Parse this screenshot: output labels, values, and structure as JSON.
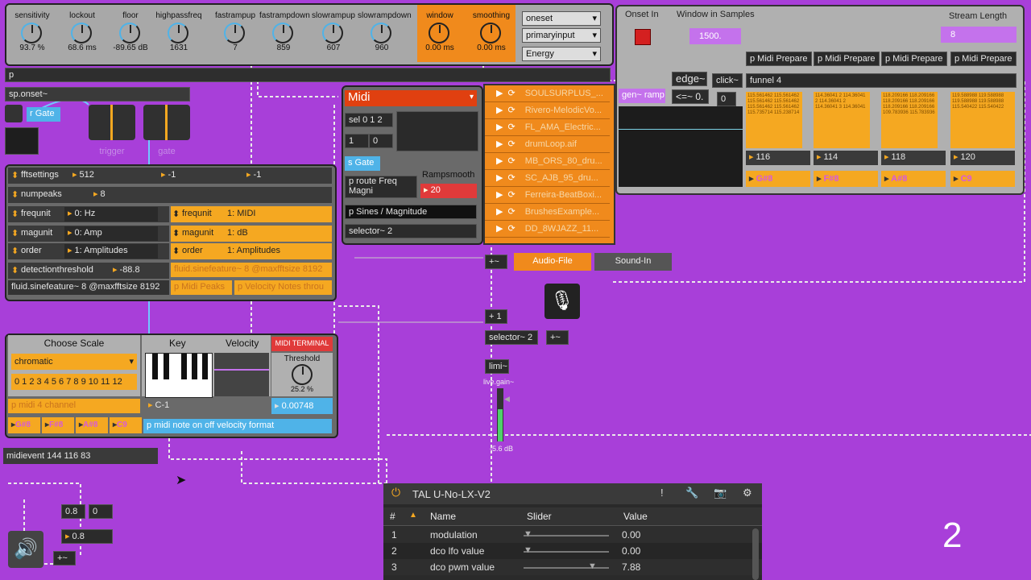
{
  "top_params": [
    {
      "label": "sensitivity",
      "value": "93.7 %"
    },
    {
      "label": "lockout",
      "value": "68.6 ms"
    },
    {
      "label": "floor",
      "value": "-89.65 dB"
    },
    {
      "label": "highpassfreq",
      "value": "1631"
    },
    {
      "label": "fastrampup",
      "value": "7"
    },
    {
      "label": "fastrampdown",
      "value": "859"
    },
    {
      "label": "slowrampup",
      "value": "607"
    },
    {
      "label": "slowrampdown",
      "value": "960"
    },
    {
      "label": "window",
      "value": "0.00 ms"
    },
    {
      "label": "smoothing",
      "value": "0.00 ms"
    }
  ],
  "menus": {
    "oneset": "oneset",
    "primaryinput": "primaryinput",
    "energy": "Energy"
  },
  "objects": {
    "p": "p",
    "sponset": "sp.onset~",
    "rgate": "r Gate",
    "trigger": "trigger",
    "gate": "gate",
    "sel012": "sel 0 1 2",
    "one": "1",
    "zero": "0",
    "sgate": "s Gate",
    "proute": "p route Freq Magni",
    "rampsmooth": "Rampsmooth",
    "ramp_val": "20",
    "psines": "p Sines / Magnitude",
    "selector2": "selector~ 2",
    "midi_menu": "Midi",
    "plusneg": "+~",
    "audio_file": "Audio-File",
    "sound_in": "Sound-In",
    "plus1": "+ 1",
    "selector2b": "selector~ 2",
    "plusb": "+~",
    "limi": "limi~",
    "livegain": "live.gain~",
    "db": "-5.6 dB",
    "midievent": "midievent 144 116 83",
    "v08a": "0.8",
    "v0": "0",
    "v08b": "0.8",
    "plusc": "+~"
  },
  "fluid": [
    {
      "name": "fftsettings",
      "v1": "512",
      "v2": "-1",
      "v3": "-1"
    },
    {
      "name": "numpeaks",
      "v1": "8"
    },
    {
      "name": "frequnit",
      "v1": "0: Hz",
      "name2": "frequnit",
      "v2": "1: MIDI"
    },
    {
      "name": "magunit",
      "v1": "0: Amp",
      "name2": "magunit",
      "v2": "1: dB"
    },
    {
      "name": "order",
      "v1": "1: Amplitudes",
      "name2": "order",
      "v2": "1: Amplitudes"
    },
    {
      "name": "detectionthreshold",
      "v1": "-88.8"
    }
  ],
  "fluid_texts": {
    "sinefeature_a": "fluid.sinefeature~ 8 @maxfftsize 8192",
    "sinefeature_b": "fluid.sinefeature~ 8 @maxfftsize 8192",
    "pmidipeaks": "p Midi Peaks",
    "pvelocity": "p Velocity Notes throu"
  },
  "clips": [
    "SOULSURPLUS_...",
    "Rivero-MelodicVo...",
    "FL_AMA_Electric...",
    "drumLoop.aif",
    "MB_ORS_80_dru...",
    "SC_AJB_95_dru...",
    "Ferreira-BeatBoxi...",
    "BrushesExample...",
    "DD_8WJAZZ_11..."
  ],
  "onset_panel": {
    "onset_in": "Onset In",
    "window_samples": "Window in Samples",
    "window_val": "1500.",
    "stream_length": "Stream Length",
    "stream_val": "8",
    "genramp": "gen~ ramp",
    "edge": "edge~",
    "click": "click~",
    "lte": "<=~ 0.",
    "zero": "0",
    "funnel": "funnel 4",
    "prepare": [
      "p Midi Prepare",
      "p Midi Prepare",
      "p Midi Prepare",
      "p Midi Prepare"
    ],
    "numbers": [
      "116",
      "114",
      "118",
      "120"
    ],
    "notes": [
      "G#8",
      "F#8",
      "A#8",
      "C9"
    ],
    "seq": [
      "115.561462 115.561462 115.561462 115.561462 115.561462 115.561462 115.735714 115.238714",
      "114.36041 2 114.36041 2 114.36041 2 114.36041 3 114.36041",
      "118.209166 118.209166 118.209166 118.209166 118.209166 118.209166 109.783936 115.783936",
      "119.588988 119.588988 119.588988 119.588988 115.540422 115.540422"
    ]
  },
  "scale_panel": {
    "choose_scale": "Choose Scale",
    "scale": "chromatic",
    "degrees": "0 1 2 3 4 5 6 7 8 9 10 11 12",
    "key": "Key",
    "velocity": "Velocity",
    "midi_terminal": "MIDI TERMINAL",
    "threshold": "Threshold",
    "threshold_val": "25.2 %",
    "pmidi4": "p midi 4 channel",
    "c1": "C-1",
    "thr_num": "0.00748",
    "notes": [
      "G#8",
      "F#8",
      "A#8",
      "C9"
    ],
    "pnote": "p midi note on off velocity format"
  },
  "plugin": {
    "title": "TAL U-No-LX-V2",
    "headers": {
      "num": "#",
      "name": "Name",
      "slider": "Slider",
      "value": "Value"
    },
    "rows": [
      {
        "num": "1",
        "name": "modulation",
        "value": "0.00",
        "level": 0
      },
      {
        "num": "2",
        "name": "dco lfo value",
        "value": "0.00",
        "level": 0
      },
      {
        "num": "3",
        "name": "dco pwm value",
        "value": "7.88",
        "level": 0.8
      }
    ]
  },
  "slide_number": "2"
}
